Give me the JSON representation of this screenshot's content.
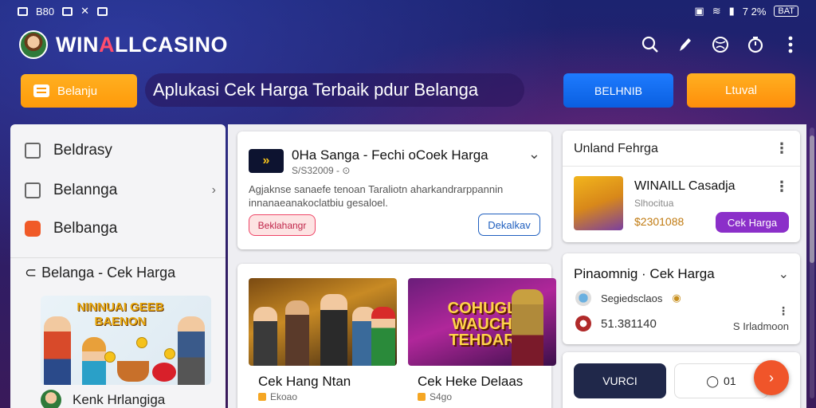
{
  "status_bar": {
    "left_text": "B80",
    "right_text": "7 2%",
    "battery": "BAT"
  },
  "header": {
    "brand_prefix": "WIN",
    "brand_accent": "A",
    "brand_suffix": "LLCASINO",
    "icons": [
      "search-icon",
      "pen-icon",
      "globe-icon",
      "clock-icon",
      "more-vertical-icon"
    ]
  },
  "actions": {
    "left_button": "Belanju",
    "tagline": "Aplukasi Cek Harga Terbaik pdur Belanga",
    "blue_button": "BELHNIB",
    "orange_button": "Ltuval"
  },
  "sidebar": {
    "items": [
      {
        "label": "Beldrasy",
        "icon": "checkbox-icon"
      },
      {
        "label": "Belannga",
        "icon": "envelope-icon",
        "chevron": "›"
      },
      {
        "label": "Belbanga",
        "icon": "tag-icon"
      }
    ],
    "section_title": "Belanga - Cek Harga",
    "art_title": "NINNUAI GEEB BAENON",
    "footer_label": "Kenk Hrlangiga"
  },
  "feed_card": {
    "title": "0Ha Sanga - Fechi oCoek Harga",
    "subtitle": "S/S32009 -",
    "description": "Agjaknse sanaefe tenoan Taraliotn aharkandrarppannin innanaeanakoclatbiu gesaloel.",
    "tag": "Beklahangr",
    "action": "Dekalkav"
  },
  "games": [
    {
      "title": "Cek Hang Ntan",
      "meta": "Ekoao",
      "banner": ""
    },
    {
      "title": "Cek Heke Delaas",
      "meta": "S4go",
      "banner": "COHUGL WAUCH TEHDAR"
    }
  ],
  "price_card": {
    "title": "Unland Fehrga",
    "item_name": "WINAILL Casadja",
    "item_sub": "Slhocitua",
    "price": "$2301088",
    "button": "Cek Harga"
  },
  "compare_card": {
    "title": "Pinaomnig · Cek Harga",
    "row1": "Segiedsclaos",
    "row2": "51.381140",
    "right_text": "S Irladmoon"
  },
  "bottom_card": {
    "dark_button": "VURCI",
    "light_button": "01"
  },
  "colors": {
    "brand_accent": "#ff4d6d",
    "orange": "#ff9a0a",
    "blue": "#0a5fe0",
    "purple": "#8b2fc9",
    "fab": "#f0552a"
  }
}
